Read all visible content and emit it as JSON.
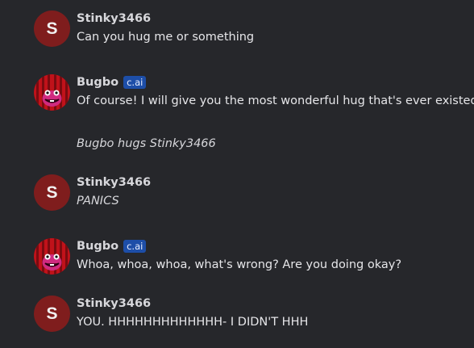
{
  "messages": [
    {
      "author": "Stinky3466",
      "avatar_letter": "S",
      "text": "Can you hug me or something"
    },
    {
      "author": "Bugbo",
      "badge": "c.ai",
      "text": "Of course! I will give you the most wonderful hug that's ever existed!",
      "action": "Bugbo hugs Stinky3466"
    },
    {
      "author": "Stinky3466",
      "avatar_letter": "S",
      "text": "PANICS"
    },
    {
      "author": "Bugbo",
      "badge": "c.ai",
      "text": "Whoa, whoa, whoa, what's wrong? Are you doing okay?"
    },
    {
      "author": "Stinky3466",
      "avatar_letter": "S",
      "text": "YOU. HHHHHHHHHHHHH- I DIDN'T HHH"
    }
  ],
  "colors": {
    "background": "#26272b",
    "user_avatar": "#7f1d1d",
    "badge": "#1d4ea8"
  },
  "icons": {
    "bot_avatar": "red-striped-creature-avatar"
  }
}
